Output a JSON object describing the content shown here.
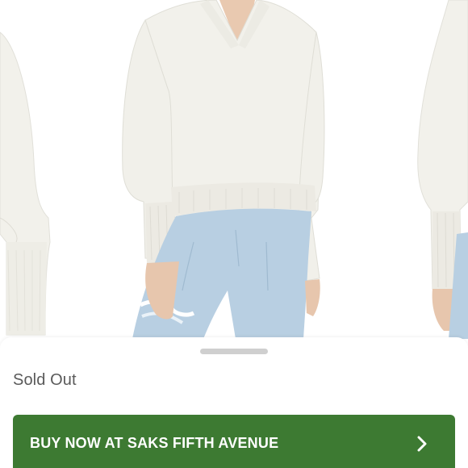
{
  "product": {
    "status": "Sold Out"
  },
  "cta": {
    "label": "BUY NOW AT SAKS FIFTH AVENUE",
    "icon": "chevron-right-icon"
  },
  "colors": {
    "cta_background": "#3d7a32",
    "cta_text": "#ffffff",
    "status_text": "#5a5a5a",
    "handle": "#cfcfcf",
    "sweater": "#f1f0ea",
    "denim": "#b7cde0"
  }
}
